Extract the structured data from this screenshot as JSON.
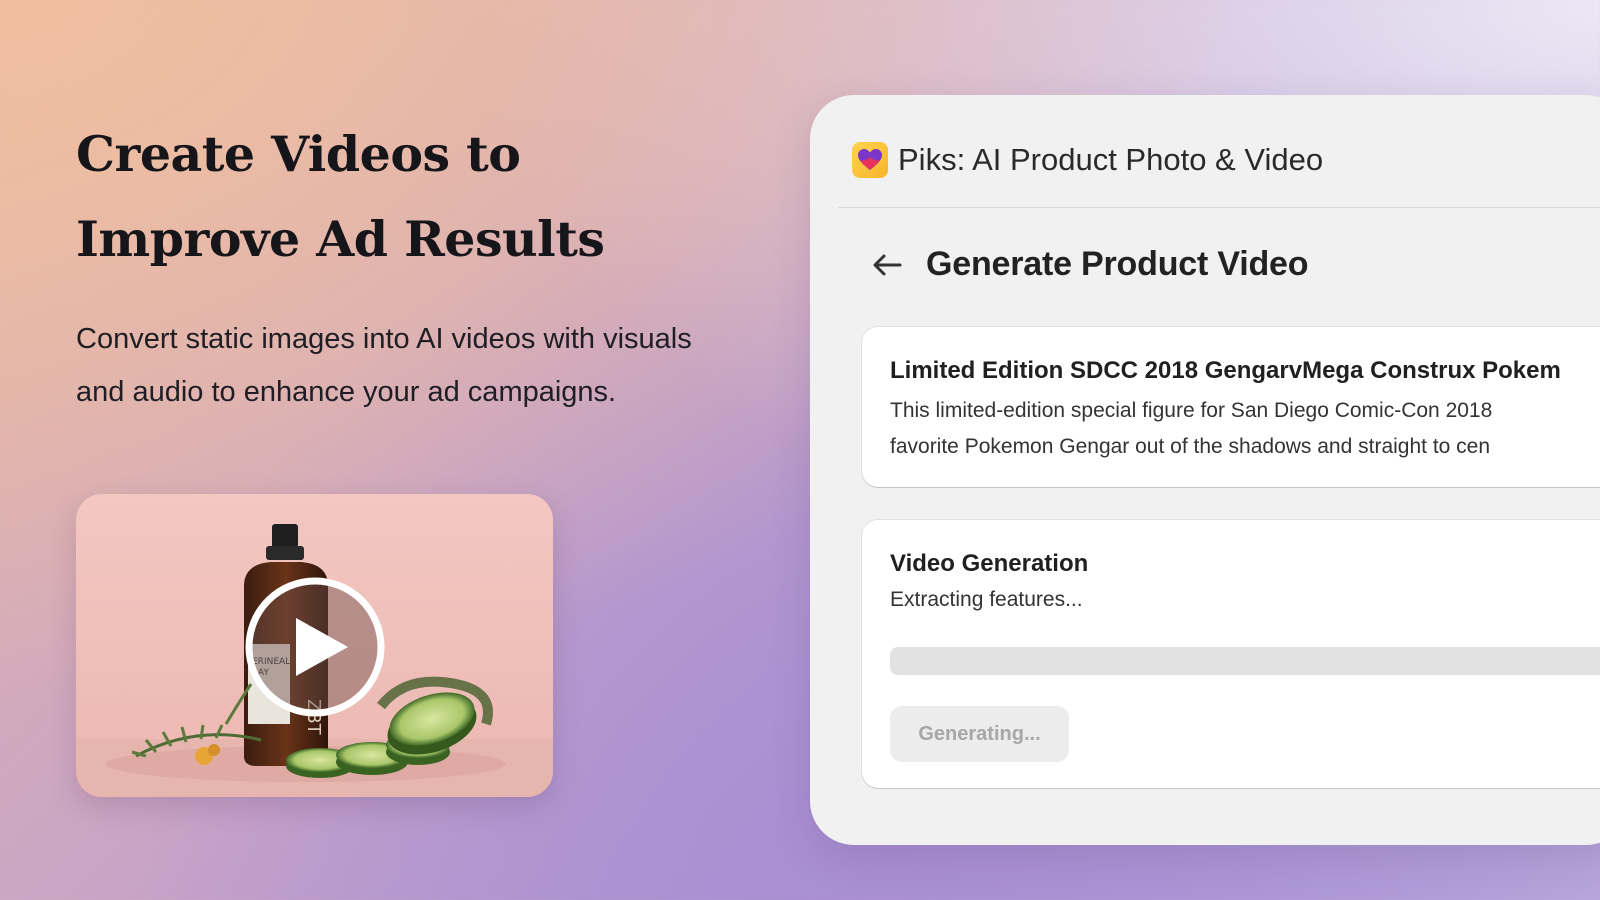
{
  "hero": {
    "title_line1": "Create Videos to",
    "title_line2": "Improve Ad Results",
    "subtitle_line1": "Convert static images into AI videos with visuals",
    "subtitle_line2": "and audio to enhance your ad campaigns."
  },
  "video": {
    "bottle_label_line1": "ERINEAL",
    "bottle_label_line2": "RAY",
    "bottle_side_text": "ZBT"
  },
  "app": {
    "title": "Piks: AI Product Photo & Video",
    "logo_icon": "heart-icon"
  },
  "page": {
    "title": "Generate Product Video",
    "back_icon": "arrow-left-icon"
  },
  "product": {
    "name": "Limited Edition SDCC 2018 GengarvMega Construx Pokem",
    "description_line1": "This limited-edition special figure for San Diego Comic-Con 2018",
    "description_line2": "favorite Pokemon Gengar out of the shadows and straight to cen"
  },
  "generation": {
    "heading": "Video Generation",
    "status": "Extracting features...",
    "progress": 0,
    "button_label": "Generating..."
  },
  "colors": {
    "panel_bg": "#f1f1f1",
    "logo_yellow": "#ffd34d",
    "progress_track": "#e2e2e2",
    "button_disabled_text": "#a7a7a7"
  }
}
